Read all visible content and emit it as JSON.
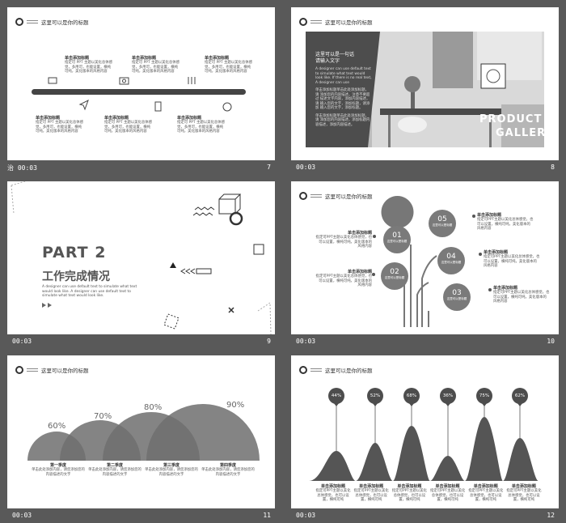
{
  "slide_title": "这里可以是你的标题",
  "thumbs": [
    {
      "time": "00:03",
      "num": "7",
      "prefix": "治"
    },
    {
      "time": "00:03",
      "num": "8"
    },
    {
      "time": "00:03",
      "num": "9"
    },
    {
      "time": "00:03",
      "num": "10"
    },
    {
      "time": "00:03",
      "num": "11"
    },
    {
      "time": "00:03",
      "num": "12"
    }
  ],
  "s7": {
    "heading": "单击添加标题",
    "body": "指定可 PPT 主题以美化总体感觉，多用可，也能设置，横纯可纯，美化版本的风格内容",
    "icons": [
      "tv-icon",
      "send-icon",
      "camera-icon",
      "phone-icon",
      "rocket-icon",
      "tag-icon"
    ]
  },
  "s8": {
    "heading": "这里可以是一句话\n请输入文字",
    "p1": "A designer can use default text to simulate what text would look like. If there is no real text, A designer can use",
    "p2": "单击添加标题单击此处添加标题，请 添加您的内容描述，注意不要超过 描述文字内容，添加内容描述，请 输入您的文字，添加标题，请添加 输入您的文字，添加标题。",
    "p3": "单击添加标题单击此处添加标题，请 添加您的内容描述，添加标题内 容描述，添加内容描述。",
    "product": "PRODUCT",
    "gallery": "GALLERY"
  },
  "s9": {
    "part": "PART  2",
    "subtitle": "工作完成情况",
    "desc": "A designer can use default text to simulate what text would look like. A designer can use default text to simulate what text would look like."
  },
  "s10": {
    "items": [
      {
        "num": "01",
        "label": "这里可以是标题",
        "sub": "添加标题内容描述添加"
      },
      {
        "num": "02",
        "label": "这里可以是标题",
        "sub": "添加标题内容描述添加"
      },
      {
        "num": "03",
        "label": "这里可以是标题",
        "sub": "添加标题内容描述添加"
      },
      {
        "num": "04",
        "label": "这里可以是标题",
        "sub": "添加标题内容描述添加"
      },
      {
        "num": "05",
        "label": "这里可以是标题",
        "sub": "添加标题内容描述添加"
      }
    ],
    "note_heading": "单击添加标题",
    "note_body": "指定可PPT主题以美化总体感觉，也可以设置，横纯可纯，美化版本的风格内容"
  },
  "s11": {
    "labels": [
      "第一季度",
      "第二季度",
      "第三季度",
      "第四季度"
    ],
    "values": [
      "60%",
      "70%",
      "80%",
      "90%"
    ],
    "desc": "单击此处添加内容，请您添加您的内容描述的文字"
  },
  "s12": {
    "values": [
      "44%",
      "52%",
      "68%",
      "36%",
      "75%",
      "62%"
    ],
    "heading": "单击添加标题",
    "body": "指定可PPT主题以美化总体感觉，也可以设置，横纯可纯"
  }
}
